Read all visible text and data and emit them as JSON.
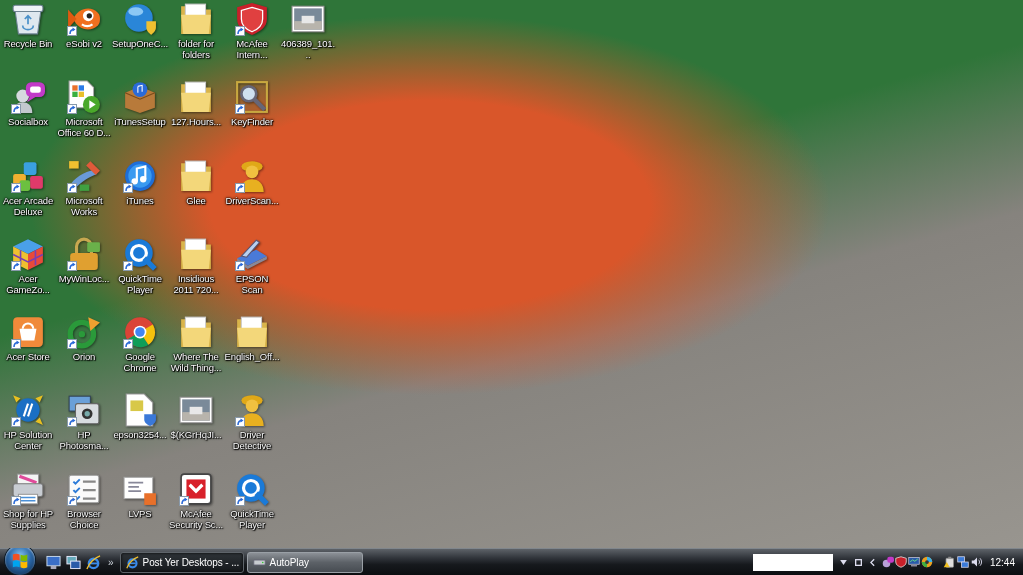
{
  "desktop": {
    "icons": [
      {
        "label": "Recycle Bin",
        "kind": "bin",
        "shortcut": false
      },
      {
        "label": "Socialbox",
        "kind": "chat",
        "shortcut": true
      },
      {
        "label": "Acer Arcade Deluxe",
        "kind": "cubes",
        "shortcut": true
      },
      {
        "label": "Acer GameZo...",
        "kind": "cube",
        "shortcut": true
      },
      {
        "label": "Acer Store",
        "kind": "bag",
        "shortcut": true
      },
      {
        "label": "HP Solution Center",
        "kind": "hp",
        "shortcut": true
      },
      {
        "label": "Shop for HP Supplies",
        "kind": "printer",
        "shortcut": true
      },
      {
        "label": "eSobi v2",
        "kind": "fish",
        "shortcut": true
      },
      {
        "label": "Microsoft Office 60 D...",
        "kind": "office",
        "shortcut": true
      },
      {
        "label": "Microsoft Works",
        "kind": "brush",
        "shortcut": true
      },
      {
        "label": "MyWinLoc...",
        "kind": "lock",
        "shortcut": true
      },
      {
        "label": "Orion",
        "kind": "target",
        "shortcut": true
      },
      {
        "label": "HP Photosma...",
        "kind": "camera",
        "shortcut": true
      },
      {
        "label": "Browser Choice",
        "kind": "checklist",
        "shortcut": true
      },
      {
        "label": "SetupOneC...",
        "kind": "sphere",
        "shortcut": false
      },
      {
        "label": "iTunesSetup",
        "kind": "box",
        "shortcut": false
      },
      {
        "label": "iTunes",
        "kind": "music",
        "shortcut": true
      },
      {
        "label": "QuickTime Player",
        "kind": "ring",
        "shortcut": true
      },
      {
        "label": "Google Chrome",
        "kind": "wheel",
        "shortcut": true
      },
      {
        "label": "epson3254...",
        "kind": "document",
        "shortcut": false
      },
      {
        "label": "LVPS",
        "kind": "slides",
        "shortcut": false
      },
      {
        "label": "folder for folders",
        "kind": "folder",
        "shortcut": false
      },
      {
        "label": "127.Hours...",
        "kind": "folder",
        "shortcut": false
      },
      {
        "label": "Glee",
        "kind": "folder",
        "shortcut": false
      },
      {
        "label": "Insidious 2011 720...",
        "kind": "folder",
        "shortcut": false
      },
      {
        "label": "Where The Wild Thing...",
        "kind": "folder",
        "shortcut": false
      },
      {
        "label": "$(KGrHqJI...",
        "kind": "picture",
        "shortcut": false
      },
      {
        "label": "McAfee Security Sc...",
        "kind": "tile",
        "shortcut": true
      },
      {
        "label": "McAfee Intern...",
        "kind": "shield",
        "shortcut": true
      },
      {
        "label": "KeyFinder",
        "kind": "magnifier",
        "shortcut": true
      },
      {
        "label": "DriverScan...",
        "kind": "figure",
        "shortcut": true
      },
      {
        "label": "EPSON Scan",
        "kind": "scanner",
        "shortcut": true
      },
      {
        "label": "English_Off...",
        "kind": "folder",
        "shortcut": false
      },
      {
        "label": "Driver Detective",
        "kind": "figure",
        "shortcut": true
      },
      {
        "label": "QuickTime Player",
        "kind": "ring",
        "shortcut": true
      },
      {
        "label": "406389_101...",
        "kind": "picture",
        "shortcut": false
      }
    ]
  },
  "taskbar": {
    "quick_launch": [
      {
        "kind": "desktop"
      },
      {
        "kind": "windows"
      },
      {
        "kind": "browser"
      }
    ],
    "more": "»",
    "tasks": [
      {
        "label": "Post Yer Desktops - ...",
        "kind": "browser",
        "selected": true
      },
      {
        "label": "AutoPlay",
        "kind": "drive",
        "selected": false
      }
    ],
    "tray_icons": [
      {
        "kind": "chat"
      },
      {
        "kind": "shield"
      },
      {
        "kind": "monitor"
      },
      {
        "kind": "disc"
      }
    ],
    "system_icons": [
      {
        "kind": "battery"
      },
      {
        "kind": "network"
      },
      {
        "kind": "speaker"
      }
    ],
    "clock": "12:44"
  }
}
